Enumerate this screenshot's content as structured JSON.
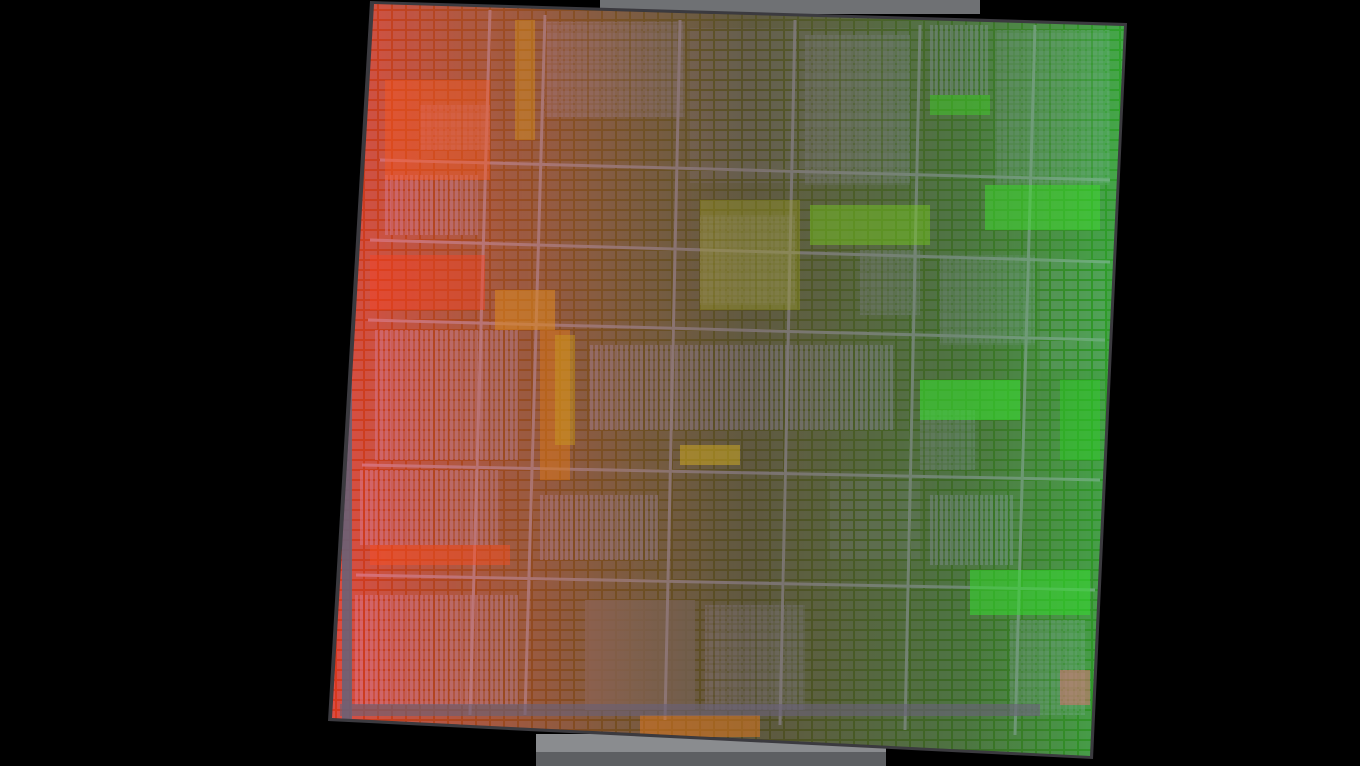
{
  "scene": {
    "subject": "die-photo",
    "background": "#000000",
    "holder_color": "#8a8c8f",
    "gradient": {
      "left": "#ff3a1c",
      "mid_left": "#e08a1a",
      "mid": "#9aa21a",
      "right": "#2cd82a"
    },
    "die_base": "#2a2530",
    "circuit_tint": "#5b4f7a"
  }
}
